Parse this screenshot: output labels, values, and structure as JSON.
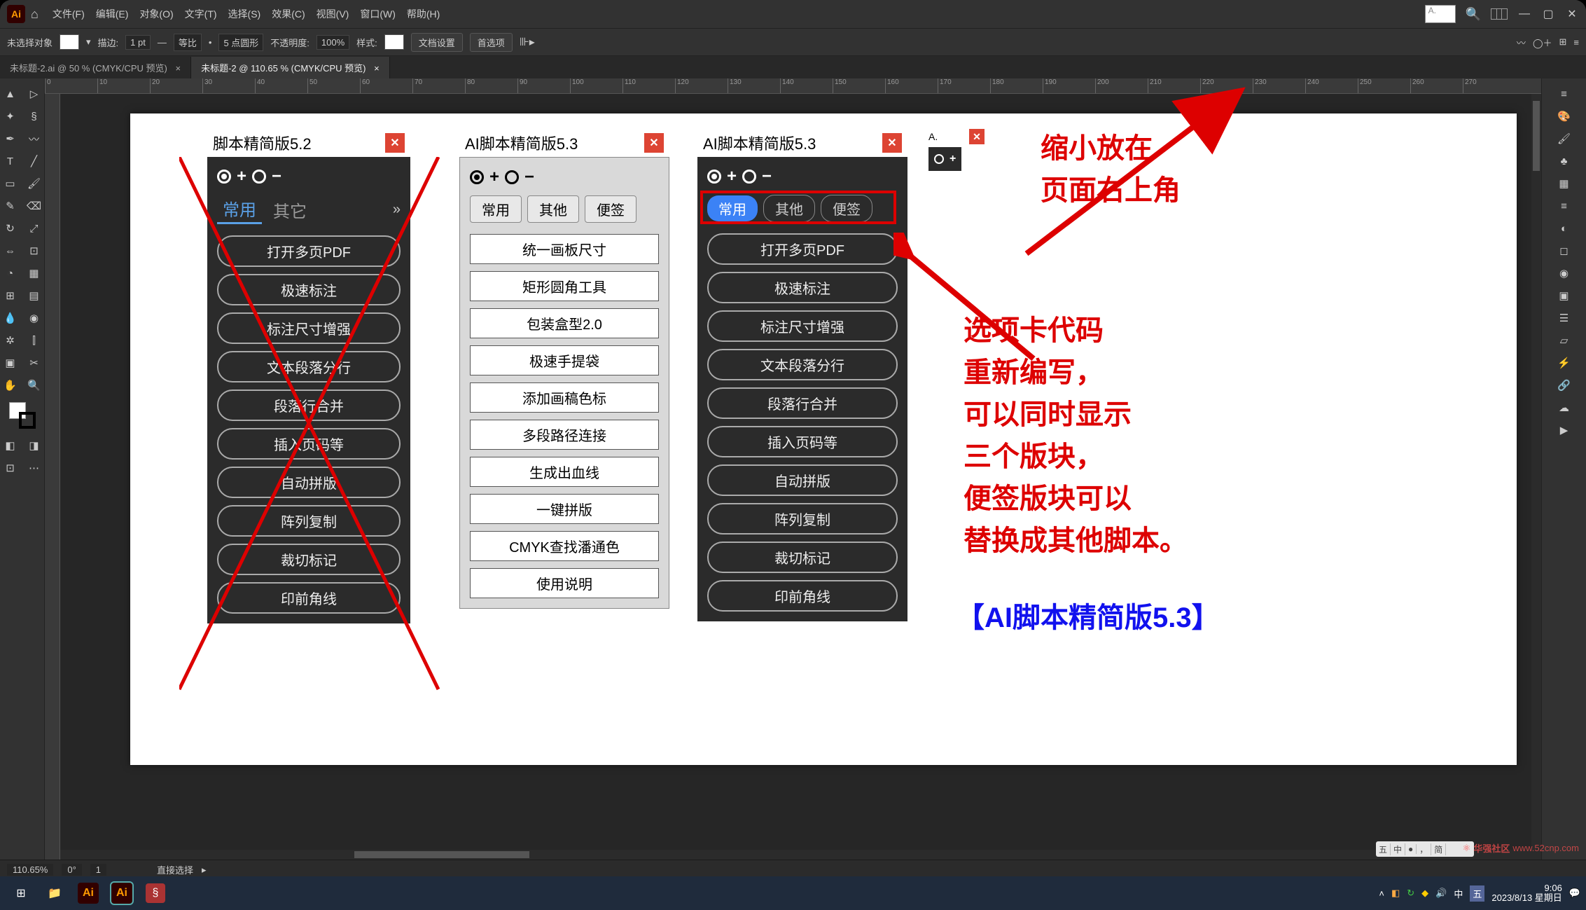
{
  "menubar": {
    "items": [
      "文件(F)",
      "编辑(E)",
      "对象(O)",
      "文字(T)",
      "选择(S)",
      "效果(C)",
      "视图(V)",
      "窗口(W)",
      "帮助(H)"
    ]
  },
  "controlbar": {
    "no_selection": "未选择对象",
    "stroke_label": "描边:",
    "stroke_value": "1 pt",
    "uniform": "等比",
    "points": "5 点圆形",
    "opacity_label": "不透明度:",
    "opacity_value": "100%",
    "style_label": "样式:",
    "doc_setup": "文档设置",
    "prefs": "首选项"
  },
  "doctabs": [
    {
      "label": "未标题-2.ai @ 50 % (CMYK/CPU 预览)",
      "active": false
    },
    {
      "label": "未标题-2 @ 110.65 % (CMYK/CPU 预览)",
      "active": true
    }
  ],
  "ruler": [
    "0",
    "10",
    "20",
    "30",
    "40",
    "50",
    "60",
    "70",
    "80",
    "90",
    "100",
    "110",
    "120",
    "130",
    "140",
    "150",
    "160",
    "170",
    "180",
    "190",
    "200",
    "210",
    "220",
    "230",
    "240",
    "250",
    "260",
    "270"
  ],
  "panel52": {
    "title": "脚本精简版5.2",
    "tabs": [
      "常用",
      "其它"
    ],
    "items": [
      "打开多页PDF",
      "极速标注",
      "标注尺寸增强",
      "文本段落分行",
      "段落行合并",
      "插入页码等",
      "自动拼版",
      "阵列复制",
      "裁切标记",
      "印前角线"
    ]
  },
  "panel53_light": {
    "title": "AI脚本精简版5.3",
    "tabs": [
      "常用",
      "其他",
      "便签"
    ],
    "items": [
      "统一画板尺寸",
      "矩形圆角工具",
      "包装盒型2.0",
      "极速手提袋",
      "添加画稿色标",
      "多段路径连接",
      "生成出血线",
      "一键拼版",
      "CMYK查找潘通色",
      "使用说明"
    ]
  },
  "panel53_dark": {
    "title": "AI脚本精简版5.3",
    "tabs": [
      "常用",
      "其他",
      "便签"
    ],
    "items": [
      "打开多页PDF",
      "极速标注",
      "标注尺寸增强",
      "文本段落分行",
      "段落行合并",
      "插入页码等",
      "自动拼版",
      "阵列复制",
      "裁切标记",
      "印前角线"
    ]
  },
  "mini_panel": {
    "title": "A."
  },
  "annotation_top": [
    "缩小放在",
    "页面右上角"
  ],
  "annotation_mid": [
    "选项卡代码",
    "重新编写，",
    "可以同时显示",
    "三个版块，",
    "便签版块可以",
    "替换成其他脚本。"
  ],
  "annotation_title": "【AI脚本精简版5.3】",
  "statusbar": {
    "zoom": "110.65%",
    "rotate": "0°",
    "artboard": "1",
    "tool": "直接选择"
  },
  "taskbar": {
    "time": "9:06",
    "date": "2023/8/13 星期日"
  },
  "watermark": "www.52cnp.com",
  "ime": [
    "五",
    "中",
    "●",
    "，",
    "简"
  ]
}
